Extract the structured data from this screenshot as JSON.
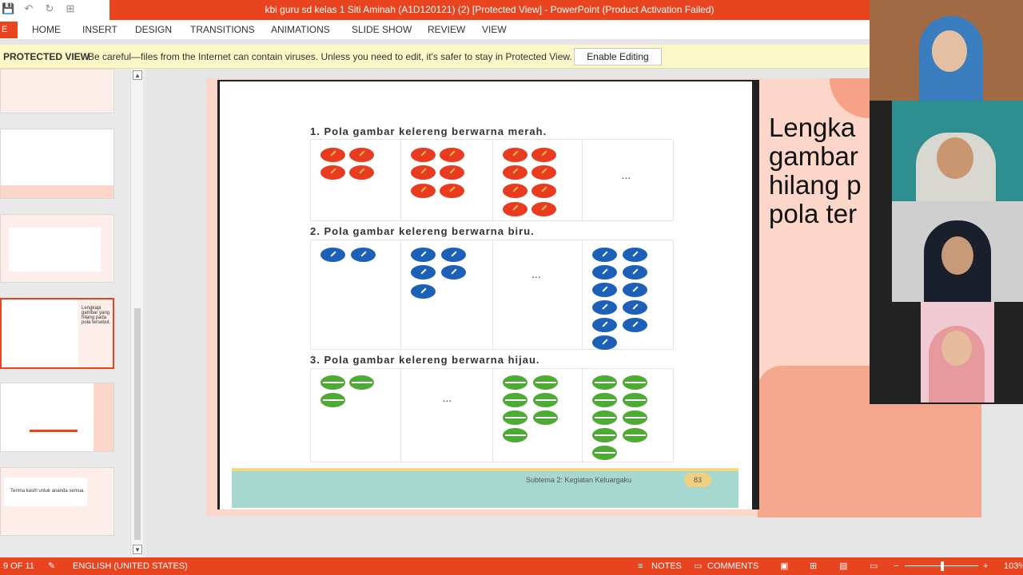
{
  "window": {
    "title": "kbi guru sd kelas 1 Siti Aminah (A1D120121) (2) [Protected View] - PowerPoint (Product Activation Failed)"
  },
  "ribbon": {
    "file_tab": "E",
    "tabs": [
      "HOME",
      "INSERT",
      "DESIGN",
      "TRANSITIONS",
      "ANIMATIONS",
      "SLIDE SHOW",
      "REVIEW",
      "VIEW"
    ]
  },
  "protected_bar": {
    "header": "PROTECTED VIEW",
    "message": "Be careful—files from the Internet can contain viruses. Unless you need to edit, it's safer to stay in Protected View.",
    "button": "Enable Editing"
  },
  "thumbnails": [
    {
      "text": "Lengkapi gambar yang hilang pada pola tersebut."
    },
    {
      "text": "Terima kasih untuk ananda semua."
    }
  ],
  "slide": {
    "questions": [
      "1.   Pola gambar kelereng berwarna merah.",
      "2.   Pola gambar kelereng berwarna biru.",
      "3.   Pola gambar kelereng berwarna hijau."
    ],
    "placeholder": "...",
    "footer_subtitle": "Subtema 2: Kegiatan Keluargaku",
    "page_number": "83",
    "side_lines": [
      "Lengka",
      "gambar",
      "hilang p",
      "pola ter"
    ]
  },
  "status": {
    "slide_counter": "9 OF 11",
    "language": "ENGLISH (UNITED STATES)",
    "notes": "NOTES",
    "comments": "COMMENTS",
    "zoom": "103%"
  },
  "colors": {
    "accent": "#e8441f",
    "marble_red": "#e83b20",
    "marble_blue": "#1c61b7",
    "marble_green": "#4eaa35"
  }
}
